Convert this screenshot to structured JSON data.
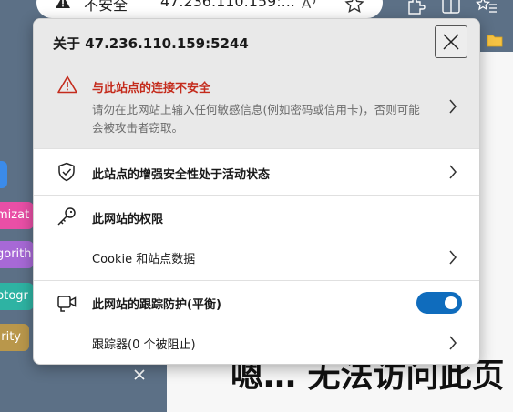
{
  "address_bar": {
    "security_label": "不安全",
    "url": "47.236.110.159:..."
  },
  "left_panel": {
    "chips": [
      {
        "label": "mizat"
      },
      {
        "label": "gorith"
      },
      {
        "label": "ptogr"
      },
      {
        "label": "rity"
      }
    ]
  },
  "page": {
    "error_heading": "嗯… 无法访问此页"
  },
  "popup": {
    "title": "关于 47.236.110.159:5244",
    "warning": {
      "title": "与此站点的连接不安全",
      "description": "请勿在此网站上输入任何敏感信息(例如密码或信用卡)，否则可能会被攻击者窃取。"
    },
    "security_row": {
      "label": "此站点的增强安全性处于活动状态"
    },
    "permissions": {
      "heading": "此网站的权限",
      "cookie_label": "Cookie 和站点数据"
    },
    "tracking": {
      "heading": "此网站的跟踪防护(平衡)",
      "enabled": true,
      "trackers_label": "跟踪器(0 个被阻止)"
    }
  },
  "colors": {
    "accent": "#0f6cbd",
    "warning": "#c42b1c",
    "chrome": "#5c7086"
  }
}
